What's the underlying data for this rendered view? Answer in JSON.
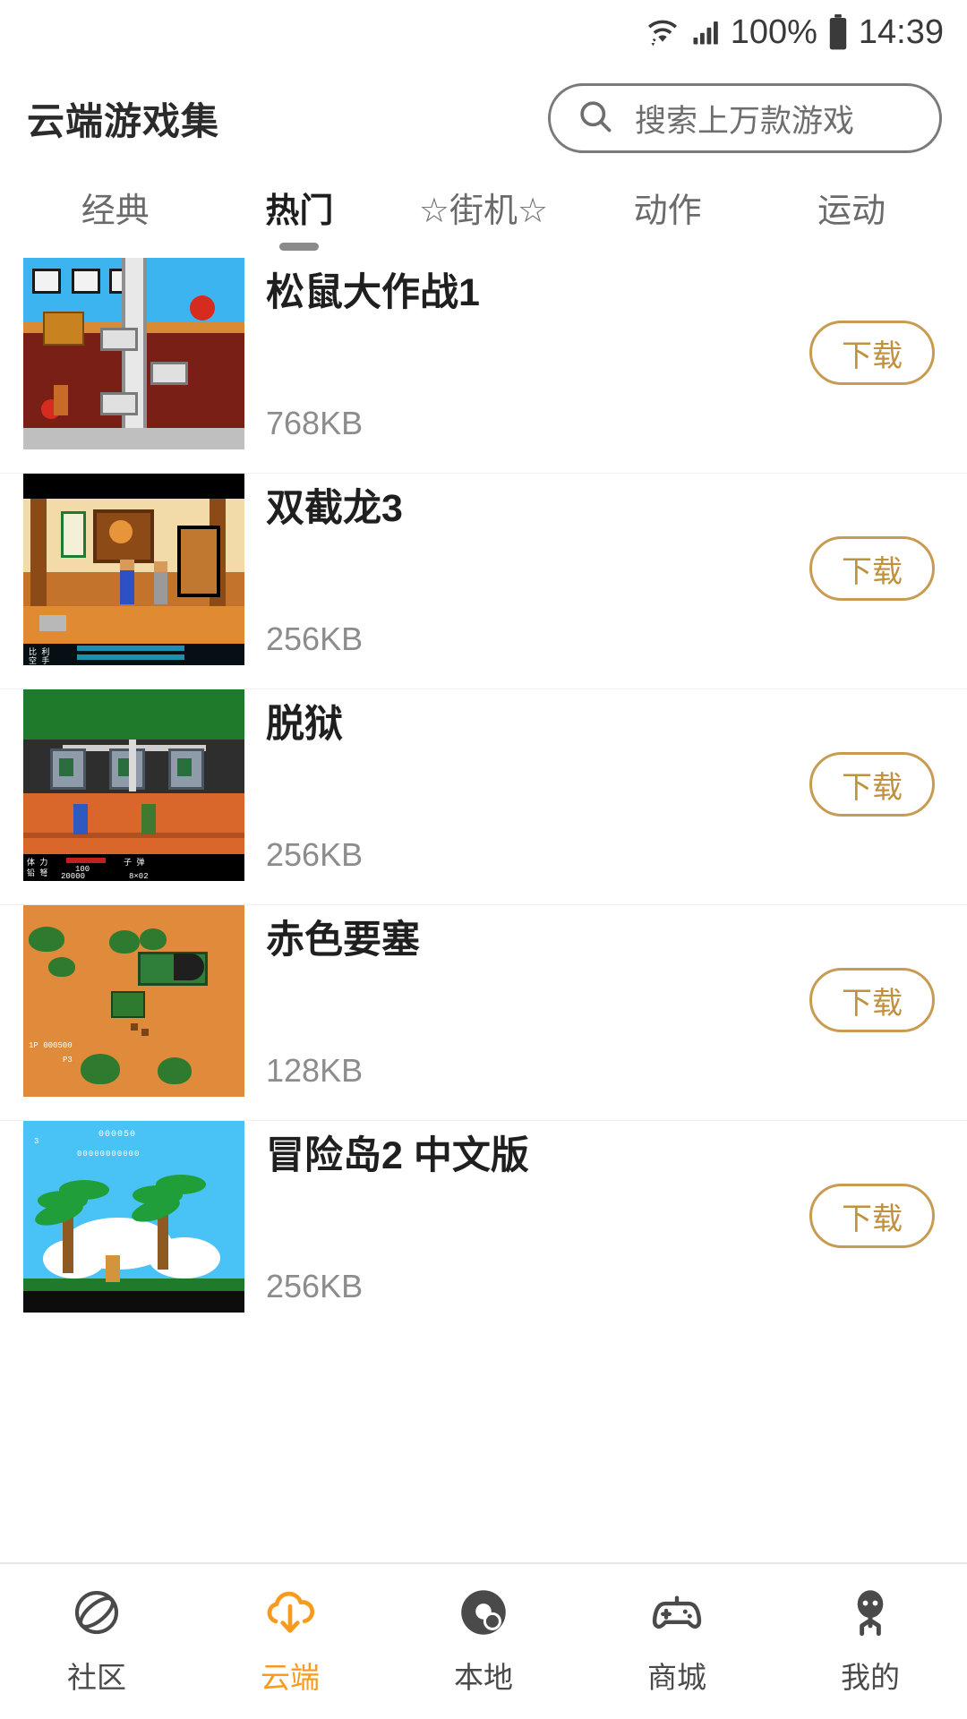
{
  "status_bar": {
    "battery_percent": "100%",
    "time": "14:39",
    "icons": [
      "wifi-icon",
      "signal-icon",
      "battery-icon"
    ]
  },
  "header": {
    "app_title": "云端游戏集",
    "search": {
      "placeholder": "搜索上万款游戏",
      "value": "",
      "icon": "search-icon"
    }
  },
  "tabs": {
    "active_index": 1,
    "items": [
      {
        "label": "经典"
      },
      {
        "label": "热门"
      },
      {
        "label": "☆街机☆"
      },
      {
        "label": "动作"
      },
      {
        "label": "运动"
      }
    ]
  },
  "game_list": {
    "download_label": "下载",
    "items": [
      {
        "title": "松鼠大作战1",
        "size": "768KB",
        "thumb": "chip-and-dale-screenshot"
      },
      {
        "title": "双截龙3",
        "size": "256KB",
        "thumb": "double-dragon-3-screenshot"
      },
      {
        "title": "脱狱",
        "size": "256KB",
        "thumb": "jail-break-screenshot"
      },
      {
        "title": "赤色要塞",
        "size": "128KB",
        "thumb": "jackal-screenshot"
      },
      {
        "title": "冒险岛2 中文版",
        "size": "256KB",
        "thumb": "adventure-island-2-screenshot"
      }
    ]
  },
  "bottom_nav": {
    "active_index": 1,
    "active_color": "#F79A1E",
    "inactive_color": "#4A4A4A",
    "items": [
      {
        "label": "社区",
        "icon": "planet-orbit-icon"
      },
      {
        "label": "云端",
        "icon": "cloud-download-icon"
      },
      {
        "label": "本地",
        "icon": "local-disc-icon"
      },
      {
        "label": "商城",
        "icon": "gamepad-icon"
      },
      {
        "label": "我的",
        "icon": "person-icon"
      }
    ]
  },
  "theme": {
    "accent": "#F79A1E",
    "download_border": "#C79B52",
    "download_text": "#C0913F",
    "title_text": "#1F1F1F",
    "size_text": "#8C8C8C"
  }
}
